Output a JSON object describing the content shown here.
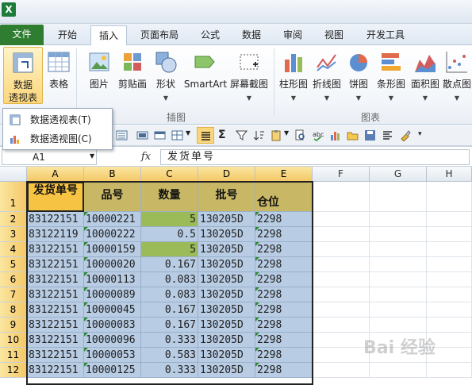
{
  "app": {
    "icon_label": "X"
  },
  "tabs": [
    {
      "label": "文件"
    },
    {
      "label": "开始"
    },
    {
      "label": "插入"
    },
    {
      "label": "页面布局"
    },
    {
      "label": "公式"
    },
    {
      "label": "数据"
    },
    {
      "label": "审阅"
    },
    {
      "label": "视图"
    },
    {
      "label": "开发工具"
    }
  ],
  "ribbon": {
    "pivot": {
      "label1": "数据",
      "label2": "透视表"
    },
    "table": {
      "label": "表格"
    },
    "picture": {
      "label": "图片"
    },
    "clipart": {
      "label": "剪贴画"
    },
    "shapes": {
      "label": "形状"
    },
    "smartart": {
      "label": "SmartArt"
    },
    "screenshot": {
      "label": "屏幕截图"
    },
    "charts": [
      "柱形图",
      "折线图",
      "饼图",
      "条形图",
      "面积图",
      "散点图"
    ],
    "group_illustrations": "插图",
    "group_charts": "图表"
  },
  "dropdown": {
    "item1": "数据透视表(T)",
    "item2": "数据透视图(C)"
  },
  "namebox": "A1",
  "fx": "fx",
  "formula": "发货单号",
  "columns": [
    "A",
    "B",
    "C",
    "D",
    "E",
    "F",
    "G",
    "H"
  ],
  "rows": [
    "1",
    "2",
    "3",
    "4",
    "5",
    "6",
    "7",
    "8",
    "9",
    "10",
    "11",
    "12"
  ],
  "headers": {
    "a": "发货单号",
    "b": "品号",
    "c": "数量",
    "d": "批号",
    "e": "仓位"
  },
  "data": [
    [
      "83122151",
      "10000221",
      "5",
      "130205D",
      "2298"
    ],
    [
      "83122119",
      "10000222",
      "0.5",
      "130205D",
      "2298"
    ],
    [
      "83122151",
      "10000159",
      "5",
      "130205D",
      "2298"
    ],
    [
      "83122151",
      "10000020",
      "0.167",
      "130205D",
      "2298"
    ],
    [
      "83122151",
      "10000113",
      "0.083",
      "130205D",
      "2298"
    ],
    [
      "83122151",
      "10000089",
      "0.083",
      "130205D",
      "2298"
    ],
    [
      "83122151",
      "10000045",
      "0.167",
      "130205D",
      "2298"
    ],
    [
      "83122151",
      "10000083",
      "0.167",
      "130205D",
      "2298"
    ],
    [
      "83122151",
      "10000096",
      "0.333",
      "130205D",
      "2298"
    ],
    [
      "83122151",
      "10000053",
      "0.583",
      "130205D",
      "2298"
    ],
    [
      "83122151",
      "10000125",
      "0.333",
      "130205D",
      "2298"
    ]
  ],
  "watermark": "Bai 经验",
  "colors": {
    "file_tab": "#2f7d31",
    "header_fill": "#c8b866",
    "data_fill": "#b8cce4",
    "highlight": "#9bbb59",
    "a1_fill": "#f6c342"
  }
}
